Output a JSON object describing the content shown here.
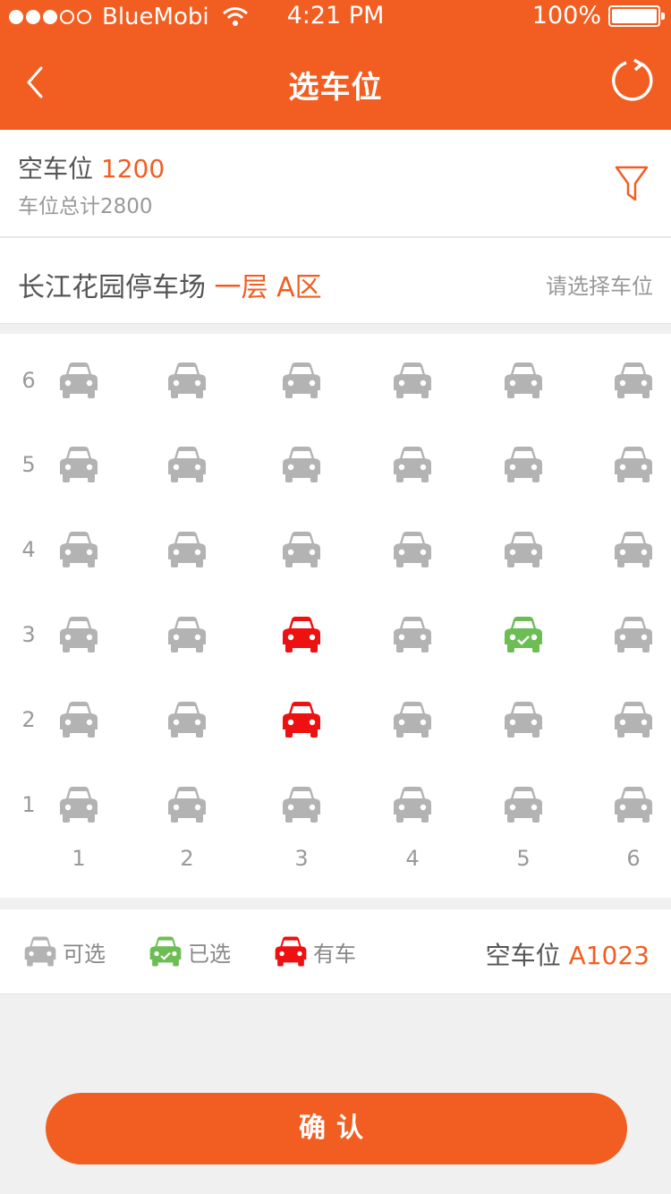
{
  "status_bar": {
    "carrier": "BlueMobi",
    "time": "4:21 PM",
    "battery": "100%"
  },
  "nav": {
    "title": "选车位"
  },
  "summary": {
    "empty_label": "空车位",
    "empty_count": "1200",
    "total_text": "车位总计2800"
  },
  "lot": {
    "name": "长江花园停车场",
    "area": "一层 A区",
    "hint": "请选择车位"
  },
  "grid": {
    "rows": [
      "6",
      "5",
      "4",
      "3",
      "2",
      "1"
    ],
    "cols": [
      "1",
      "2",
      "3",
      "4",
      "5",
      "6"
    ],
    "states": [
      [
        "available",
        "available",
        "available",
        "available",
        "available",
        "available"
      ],
      [
        "available",
        "available",
        "available",
        "available",
        "available",
        "available"
      ],
      [
        "available",
        "available",
        "available",
        "available",
        "available",
        "available"
      ],
      [
        "available",
        "available",
        "occupied",
        "available",
        "selected",
        "available"
      ],
      [
        "available",
        "available",
        "occupied",
        "available",
        "available",
        "available"
      ],
      [
        "available",
        "available",
        "available",
        "available",
        "available",
        "available"
      ]
    ]
  },
  "colors": {
    "accent": "#f25e22",
    "available": "#b3b3b3",
    "selected": "#6dbd55",
    "occupied": "#ee1111"
  },
  "legend": {
    "available": "可选",
    "selected": "已选",
    "occupied": "有车",
    "selected_label": "空车位",
    "selected_value": "A1023"
  },
  "confirm_label": "确认"
}
